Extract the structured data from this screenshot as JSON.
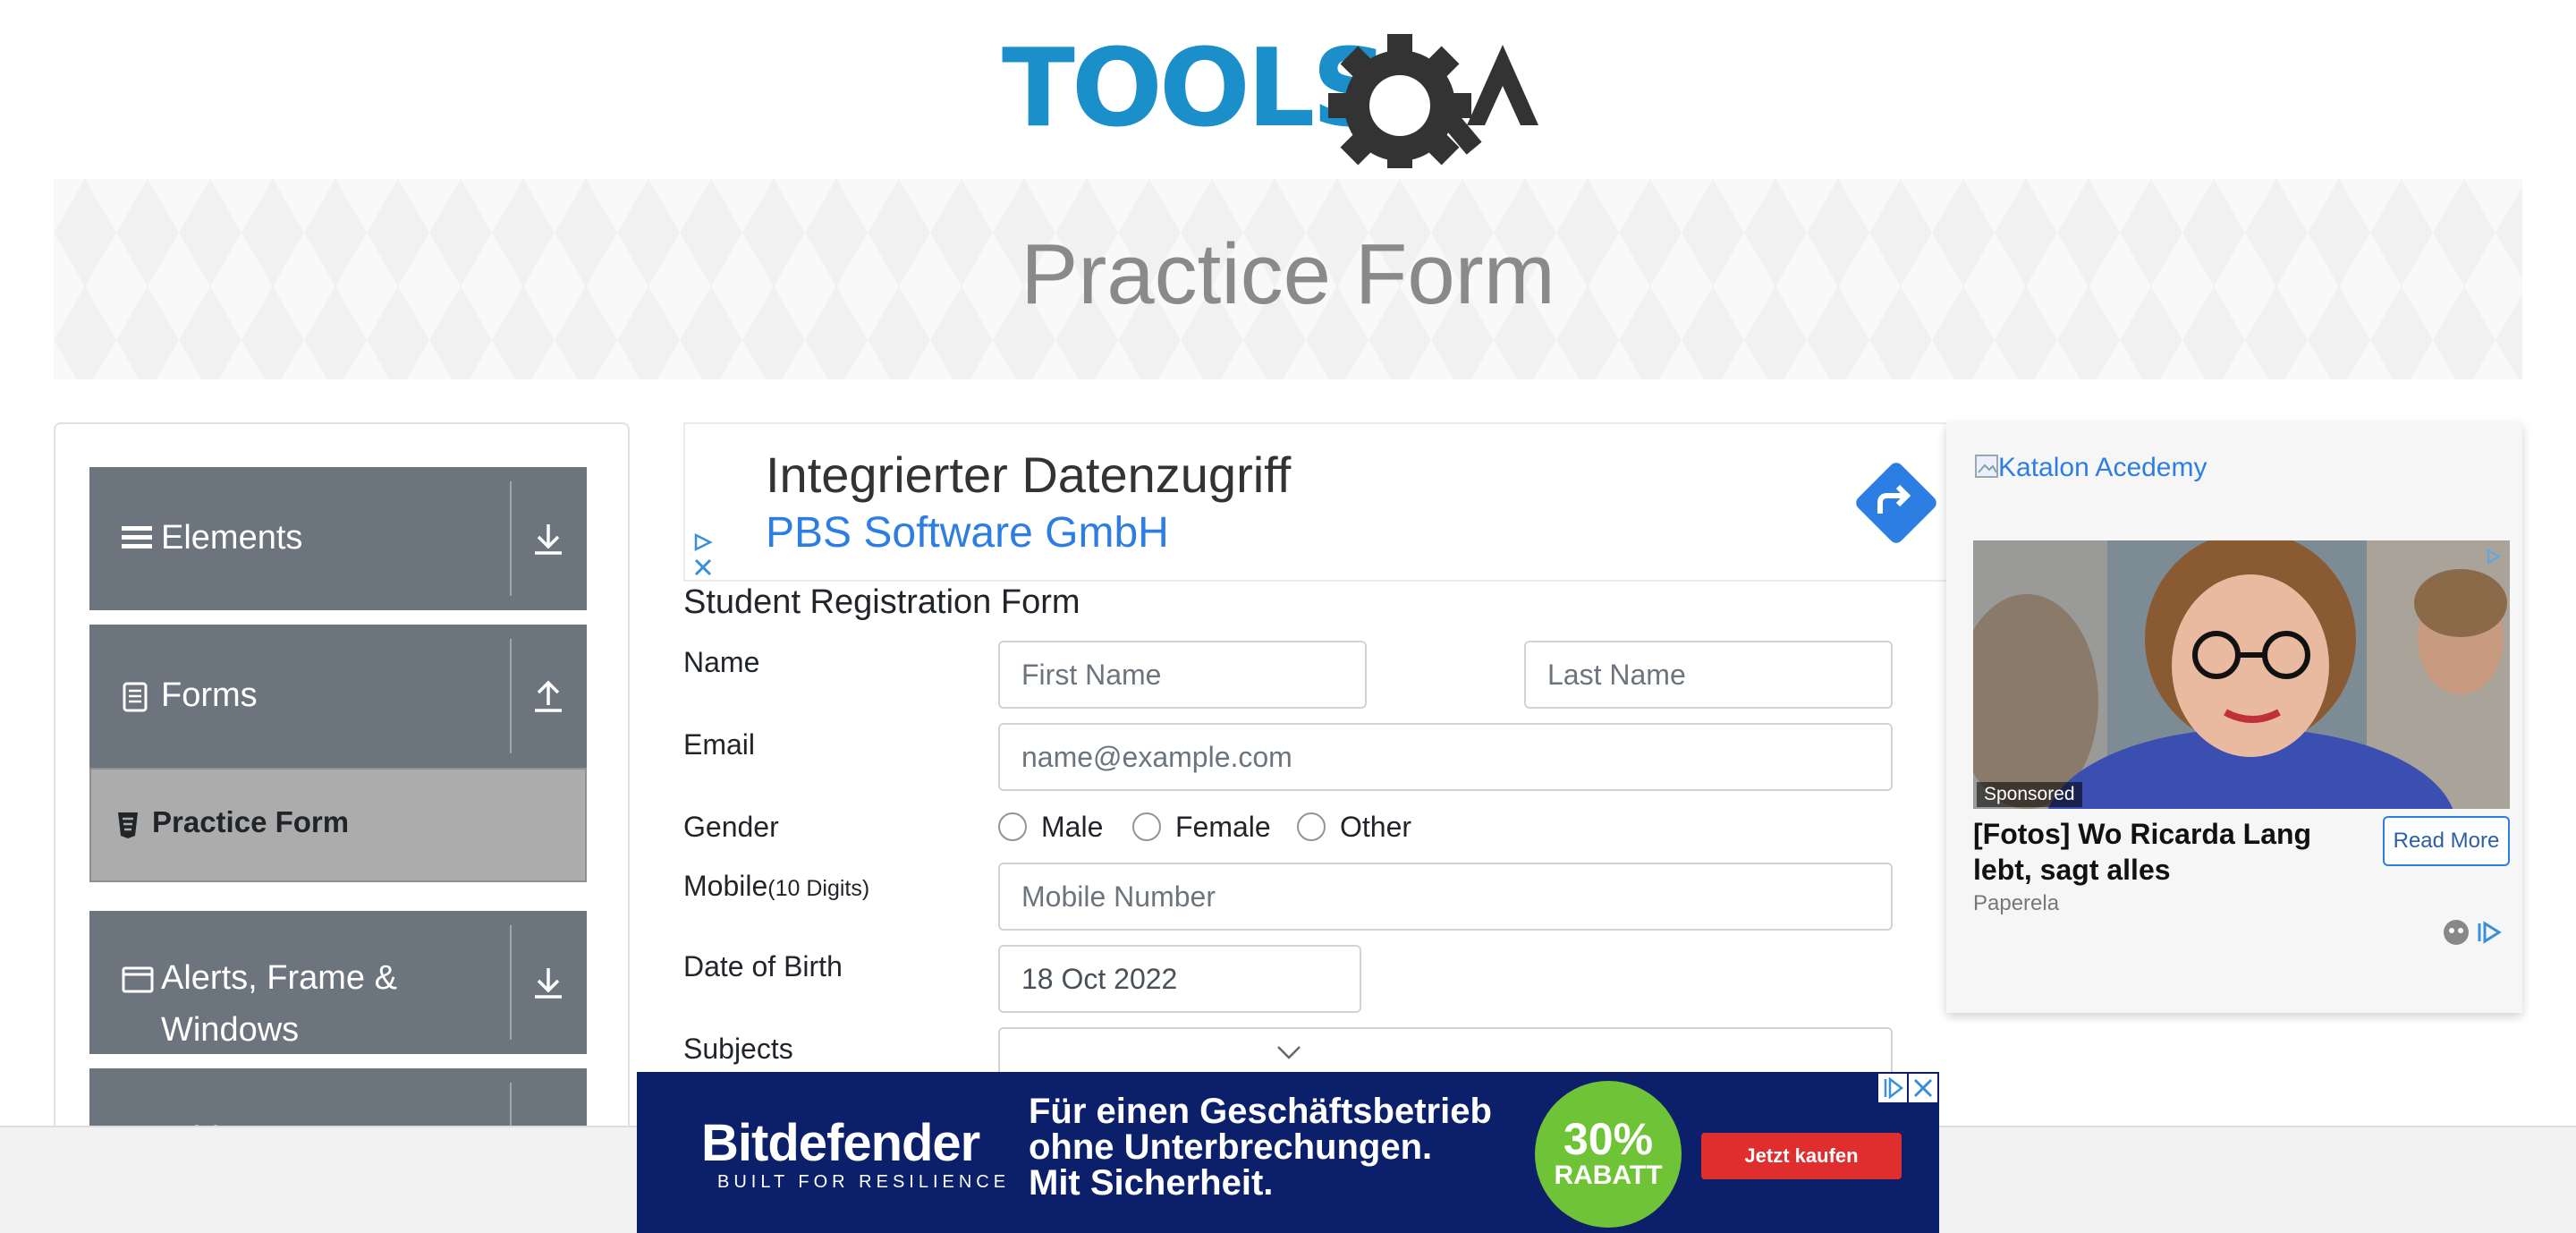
{
  "logo": {
    "text": "TOOLS",
    "suffix": "QA"
  },
  "banner": {
    "title": "Practice Form"
  },
  "nav": {
    "elements": "Elements",
    "forms": "Forms",
    "practice_form": "Practice Form",
    "alerts_line1": "Alerts, Frame &",
    "alerts_line2": "Windows",
    "widgets": "Widgets"
  },
  "ad_top": {
    "headline": "Integrierter Datenzugriff",
    "advertiser": "PBS Software GmbH"
  },
  "form": {
    "title": "Student Registration Form",
    "name_label": "Name",
    "first_name_placeholder": "First Name",
    "last_name_placeholder": "Last Name",
    "email_label": "Email",
    "email_placeholder": "name@example.com",
    "gender_label": "Gender",
    "gender_options": [
      "Male",
      "Female",
      "Other"
    ],
    "mobile_label": "Mobile",
    "mobile_hint": "(10 Digits)",
    "mobile_placeholder": "Mobile Number",
    "dob_label": "Date of Birth",
    "dob_value": "18 Oct 2022",
    "subjects_label": "Subjects"
  },
  "ad_right": {
    "image_alt": "Katalon Acedemy",
    "sponsored": "Sponsored",
    "headline": "[Fotos] Wo Ricarda Lang lebt, sagt alles",
    "read_more": "Read More",
    "source": "Paperela"
  },
  "ad_bottom": {
    "brand": "Bitdefender",
    "tagline": "BUILT FOR RESILIENCE",
    "copy_line1": "Für einen Geschäftsbetrieb",
    "copy_line2": "ohne Unterbrechungen.",
    "copy_line3": "Mit Sicherheit.",
    "discount_pct": "30%",
    "discount_label": "RABATT",
    "cta": "Jetzt kaufen"
  },
  "colors": {
    "nav_group_bg": "#6c757d",
    "nav_active_bg": "#acacac",
    "logo_blue": "#1b8fc9",
    "logo_dark": "#333333",
    "ad_bottom_bg": "#0b1f6b",
    "ad_discount_green": "#6fc336",
    "ad_cta_red": "#e02e2e"
  }
}
